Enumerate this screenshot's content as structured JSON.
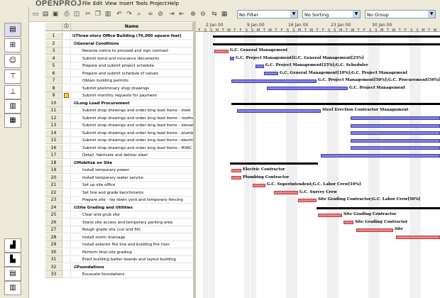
{
  "app": {
    "logo": "OPENPROJ"
  },
  "menu": [
    "File",
    "Edit",
    "View",
    "Insert",
    "Tools",
    "Project",
    "Help"
  ],
  "toolbar": {
    "filter": "No Filter",
    "sorting": "No Sorting",
    "group": "No Group"
  },
  "table": {
    "col_name": "Name"
  },
  "timeline": {
    "weeks": [
      "2 Jan 00",
      "9 Jan 00",
      "16 Jan 00",
      "23 Jan 00",
      "30 Jan 00"
    ],
    "days": "FSSMTWTFSSMTWTFSSMTWTFSSMTWTFSSMTWTFSSMTWT"
  },
  "tasks": [
    {
      "id": "1",
      "name": "Three-story Office Building (76,000 square feet)",
      "summary": true,
      "level": 0
    },
    {
      "id": "2",
      "name": "General Conditions",
      "summary": true,
      "level": 1
    },
    {
      "id": "3",
      "name": "Receive notice to proceed and sign contract",
      "level": 2
    },
    {
      "id": "4",
      "name": "Submit bond and insurance documents",
      "level": 2
    },
    {
      "id": "5",
      "name": "Prepare and submit project schedule",
      "level": 2
    },
    {
      "id": "6",
      "name": "Prepare and submit schedule of values",
      "level": 2
    },
    {
      "id": "7",
      "name": "Obtain building permits",
      "level": 2
    },
    {
      "id": "8",
      "name": "Submit preliminary shop drawings",
      "level": 2
    },
    {
      "id": "9",
      "name": "Submit monthly requests for payment",
      "level": 2,
      "note": true
    },
    {
      "id": "10",
      "name": "Long Lead Procurement",
      "summary": true,
      "level": 1
    },
    {
      "id": "11",
      "name": "Submit shop drawings and order long lead items - steel",
      "level": 2
    },
    {
      "id": "12",
      "name": "Submit shop drawings and order long lead items - roofing",
      "level": 2
    },
    {
      "id": "13",
      "name": "Submit shop drawings and order long lead items - elevator",
      "level": 2
    },
    {
      "id": "14",
      "name": "Submit shop drawings and order long lead items - plumbing",
      "level": 2
    },
    {
      "id": "15",
      "name": "Submit shop drawings and order long lead items - electric",
      "level": 2
    },
    {
      "id": "16",
      "name": "Submit shop drawings and order long lead items - HVAC",
      "level": 2
    },
    {
      "id": "17",
      "name": "Detail, fabricate and deliver steel",
      "level": 2
    },
    {
      "id": "18",
      "name": "Mobilize on Site",
      "summary": true,
      "level": 1
    },
    {
      "id": "19",
      "name": "Install temporary power",
      "level": 2
    },
    {
      "id": "20",
      "name": "Install temporary water service",
      "level": 2
    },
    {
      "id": "21",
      "name": "Set up site office",
      "level": 2
    },
    {
      "id": "22",
      "name": "Set line and grade benchmarks",
      "level": 2
    },
    {
      "id": "23",
      "name": "Prepare site - lay down yard and temporary fencing",
      "level": 2
    },
    {
      "id": "24",
      "name": "Site Grading and Utilities",
      "summary": true,
      "level": 1
    },
    {
      "id": "25",
      "name": "Clear and grub site",
      "level": 2
    },
    {
      "id": "26",
      "name": "Stone site access and temporary parking area",
      "level": 2
    },
    {
      "id": "27",
      "name": "Rough grade site (cut and fill)",
      "level": 2
    },
    {
      "id": "28",
      "name": "Install storm drainage",
      "level": 2
    },
    {
      "id": "29",
      "name": "Install exterior fire line and building fire riser",
      "level": 2
    },
    {
      "id": "30",
      "name": "Perform final site grading",
      "level": 2
    },
    {
      "id": "31",
      "name": "Erect building batter boards and layout building",
      "level": 2
    },
    {
      "id": "32",
      "name": "Foundations",
      "summary": true,
      "level": 1
    },
    {
      "id": "33",
      "name": "Excavate foundations",
      "level": 2
    }
  ],
  "bars": [
    {
      "row": 1,
      "type": "sum",
      "start": 24,
      "end": 344
    },
    {
      "row": 2,
      "type": "sum",
      "start": 24,
      "end": 344
    },
    {
      "row": 3,
      "type": "crit",
      "start": 26,
      "end": 46,
      "label": "G.C. General Management"
    },
    {
      "row": 4,
      "type": "norm",
      "start": 48,
      "end": 54,
      "label": "G.C. Project Management[G.C. General Management[25%]"
    },
    {
      "row": 5,
      "type": "norm",
      "start": 84,
      "end": 96,
      "label": "G.C. Project Management[25%];G.C. Scheduler"
    },
    {
      "row": 6,
      "type": "norm",
      "start": 96,
      "end": 116,
      "label": "G.C. General Management[10%];G.C. Project Management"
    },
    {
      "row": 7,
      "type": "norm",
      "start": 50,
      "end": 170,
      "label": "G.C. Project Management[50%];G.C. Procurement[50%]"
    },
    {
      "row": 8,
      "type": "norm",
      "start": 100,
      "end": 214,
      "label": "G.C. Project Management"
    },
    {
      "row": 10,
      "type": "sum",
      "start": 50,
      "end": 344
    },
    {
      "row": 11,
      "type": "norm",
      "start": 58,
      "end": 176,
      "label": "Steel Erection Contractor Management"
    },
    {
      "row": 12,
      "type": "norm",
      "start": 218,
      "end": 344
    },
    {
      "row": 13,
      "type": "norm",
      "start": 218,
      "end": 344
    },
    {
      "row": 14,
      "type": "norm",
      "start": 218,
      "end": 344
    },
    {
      "row": 15,
      "type": "norm",
      "start": 218,
      "end": 344
    },
    {
      "row": 16,
      "type": "norm",
      "start": 218,
      "end": 344
    },
    {
      "row": 17,
      "type": "norm",
      "start": 176,
      "end": 344
    },
    {
      "row": 18,
      "type": "sum",
      "start": 48,
      "end": 172
    },
    {
      "row": 19,
      "type": "crit",
      "start": 50,
      "end": 64,
      "label": "Electric Contractor"
    },
    {
      "row": 20,
      "type": "crit",
      "start": 50,
      "end": 64,
      "label": "Plumbing Contractor"
    },
    {
      "row": 21,
      "type": "crit",
      "start": 80,
      "end": 98,
      "label": "G.C. Superintendent;G.C. Labor Crew[10%]"
    },
    {
      "row": 22,
      "type": "crit",
      "start": 110,
      "end": 144,
      "label": "G.C. Survey Crew"
    },
    {
      "row": 23,
      "type": "crit",
      "start": 144,
      "end": 170,
      "label": "Site Grading Contractor;G.C. Labor Crew[50%]"
    },
    {
      "row": 24,
      "type": "sum",
      "start": 170,
      "end": 344
    },
    {
      "row": 25,
      "type": "crit",
      "start": 172,
      "end": 206,
      "label": "Site Grading Contractor"
    },
    {
      "row": 26,
      "type": "crit",
      "start": 208,
      "end": 222,
      "label": "Site Grading Contractor"
    },
    {
      "row": 27,
      "type": "crit",
      "start": 226,
      "end": 278,
      "label": "Site"
    },
    {
      "row": 28,
      "type": "crit",
      "start": 282,
      "end": 344
    }
  ]
}
